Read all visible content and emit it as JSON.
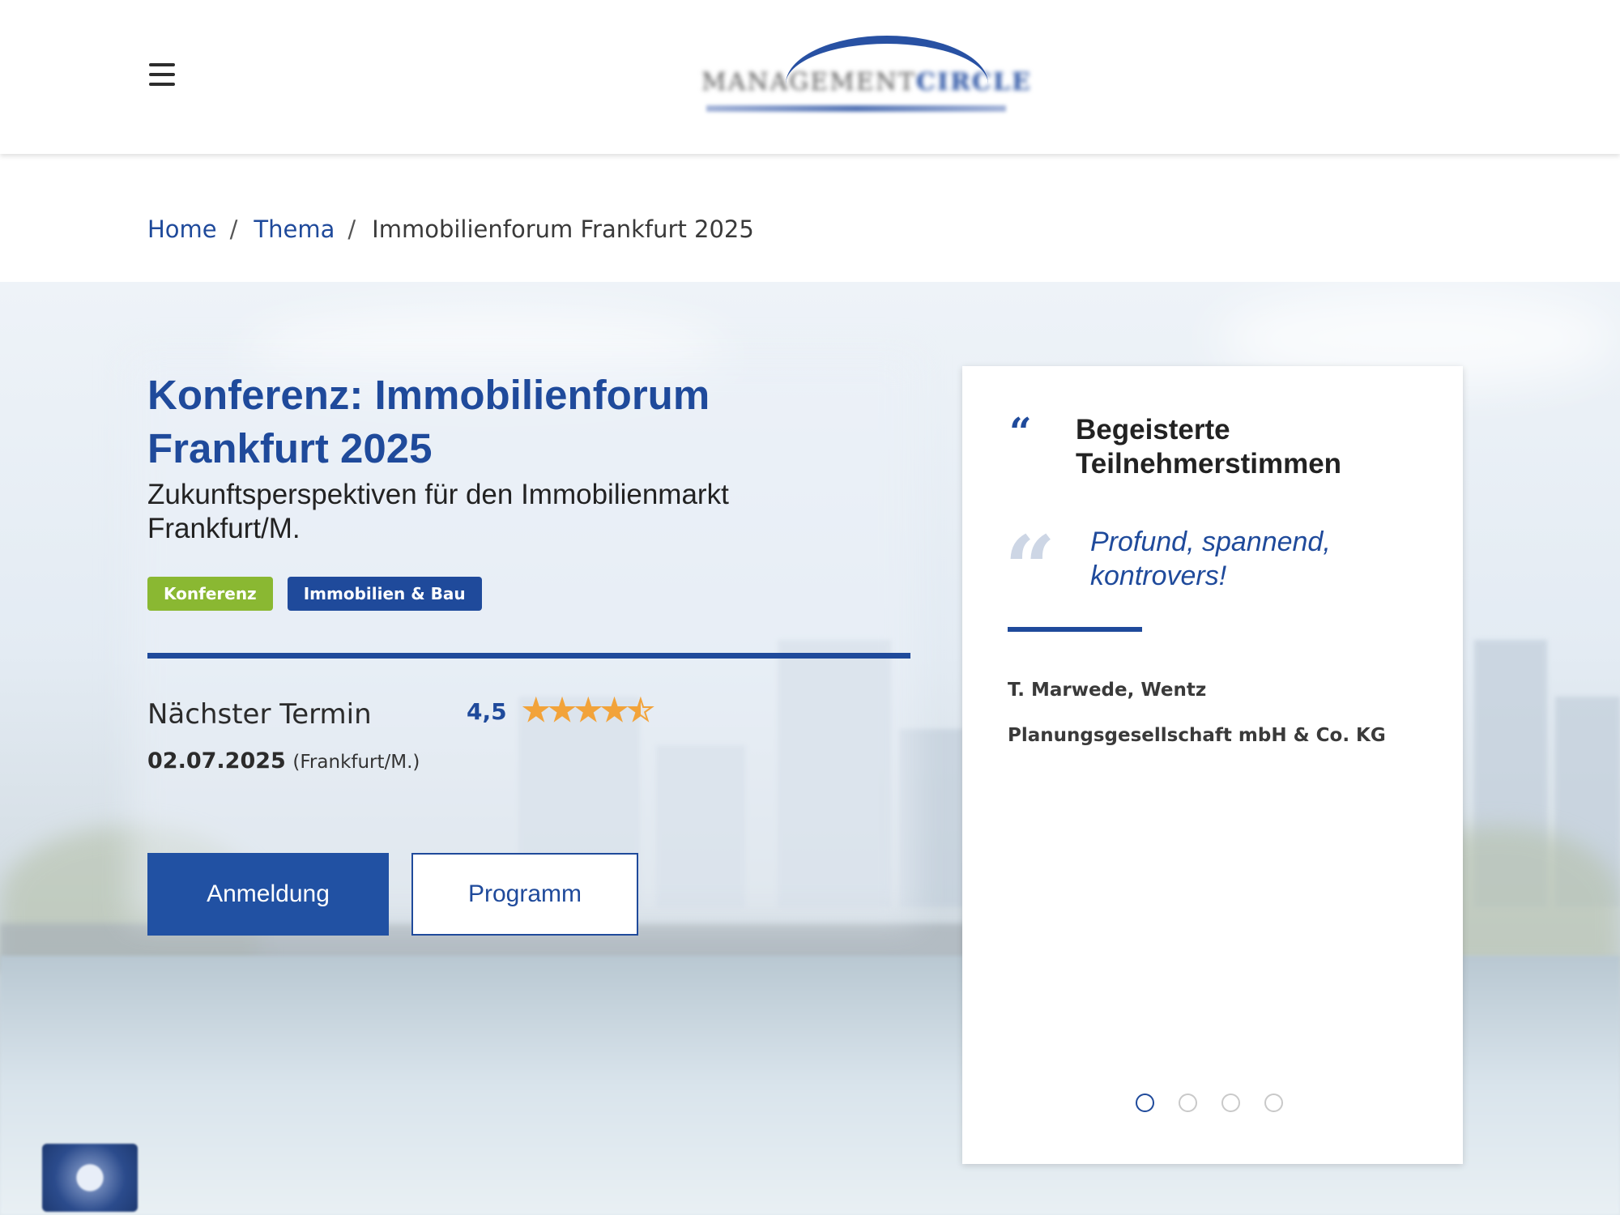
{
  "header": {
    "menu_icon": "hamburger-menu-icon",
    "logo_text_left": "MANAGEMENT",
    "logo_text_right": "CIRCLE"
  },
  "breadcrumb": {
    "items": [
      "Home",
      "Thema"
    ],
    "separator": "/",
    "current": "Immobilienforum Frankfurt 2025"
  },
  "event": {
    "title": "Konferenz: Immobilienforum Frankfurt 2025",
    "subtitle": "Zukunftsperspektiven für den Immobilienmarkt Frankfurt/M.",
    "tags": [
      {
        "label": "Konferenz",
        "color": "#8ab832"
      },
      {
        "label": "Immobilien & Bau",
        "color": "#1f4a9b"
      }
    ],
    "next_label": "Nächster Termin",
    "next_date": "02.07.2025",
    "next_location": "(Frankfurt/M.)",
    "rating": "4,5",
    "rating_value": 4.5,
    "rating_max": 5,
    "register_label": "Anmeldung",
    "program_label": "Programm"
  },
  "testimonials": {
    "heading": "Begeisterte Teilnehmerstimmen",
    "quote": "Profund, spannend, kontrovers!",
    "author": "T. Marwede, Wentz Planungsgesellschaft mbH & Co. KG",
    "slide_count": 4,
    "active_slide": 1
  },
  "colors": {
    "brand_blue": "#1f4a9b",
    "tag_green": "#8ab832",
    "star": "#f2a33a"
  }
}
